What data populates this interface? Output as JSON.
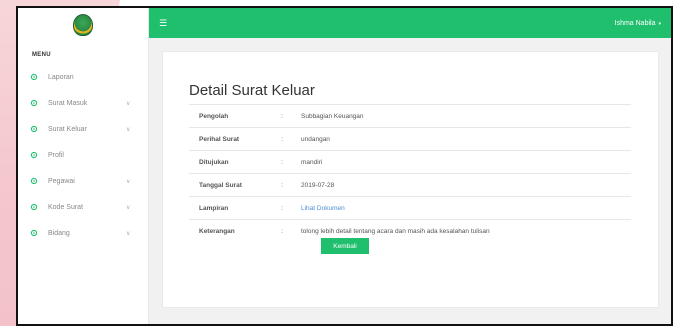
{
  "sidebar": {
    "menu_title": "MENU",
    "items": [
      {
        "label": "Laporan",
        "icon": "gear-icon",
        "has_chevron": false
      },
      {
        "label": "Surat Masuk",
        "icon": "gear-icon",
        "has_chevron": true
      },
      {
        "label": "Surat Keluar",
        "icon": "gear-icon",
        "has_chevron": true
      },
      {
        "label": "Profil",
        "icon": "gear-icon",
        "has_chevron": false
      },
      {
        "label": "Pegawai",
        "icon": "gear-icon",
        "has_chevron": true
      },
      {
        "label": "Kode Surat",
        "icon": "gear-icon",
        "has_chevron": true
      },
      {
        "label": "Bidang",
        "icon": "gear-icon",
        "has_chevron": true
      }
    ]
  },
  "topbar": {
    "menu_icon": "hamburger-icon",
    "user_name": "Ishma Nabila",
    "caret": "▾",
    "accent": "#1fbf6e"
  },
  "card": {
    "title": "Detail Surat Keluar",
    "rows": [
      {
        "key": "Pengolah",
        "sep": ":",
        "value": "Subbagian Keuangan"
      },
      {
        "key": "Perihal Surat",
        "sep": ":",
        "value": "undangan"
      },
      {
        "key": "Ditujukan",
        "sep": ":",
        "value": "mandiri"
      },
      {
        "key": "Tanggal Surat",
        "sep": ":",
        "value": "2019-07-28"
      },
      {
        "key": "Lampiran",
        "sep": ":",
        "value": "Lihat Dokumen"
      },
      {
        "key": "Keterangan",
        "sep": ":",
        "value": "tolong lebih detail tentang acara dan masih ada kesalahan tulisan"
      }
    ],
    "back_button": "Kembali"
  }
}
